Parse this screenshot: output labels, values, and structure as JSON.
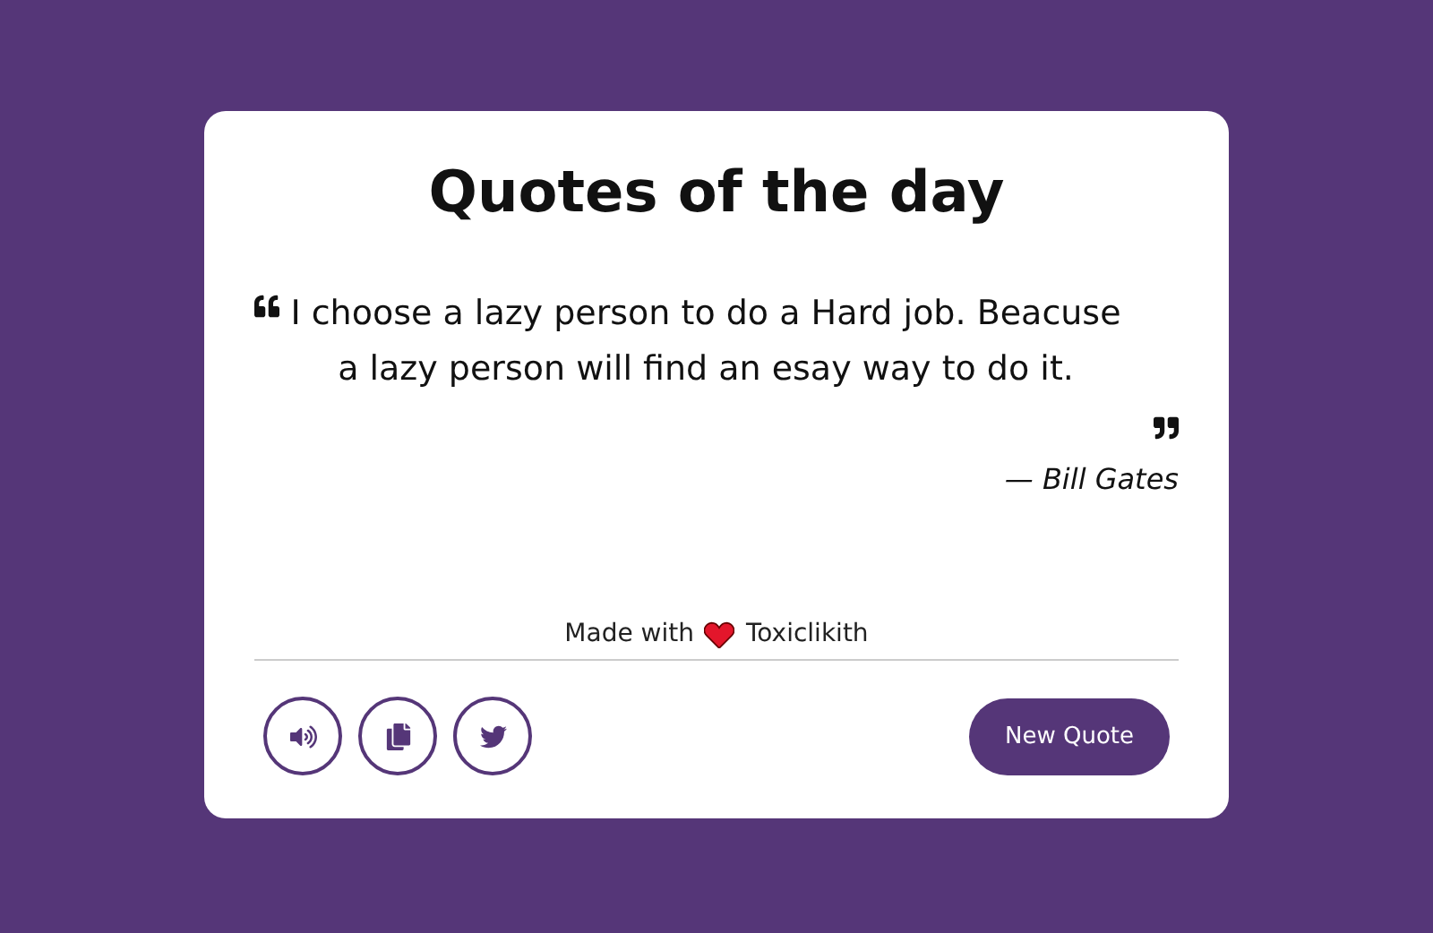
{
  "title": "Quotes of the day",
  "quote": {
    "text": "I choose a lazy person to do a Hard job. Beacuse a lazy person will find an esay way to do it.",
    "author": "— Bill Gates"
  },
  "footer": {
    "prefix": "Made with",
    "suffix": "Toxiclikith"
  },
  "actions": [
    {
      "kind": "speak"
    },
    {
      "kind": "copy"
    },
    {
      "kind": "share"
    }
  ],
  "new_quote_button": "New Quote"
}
